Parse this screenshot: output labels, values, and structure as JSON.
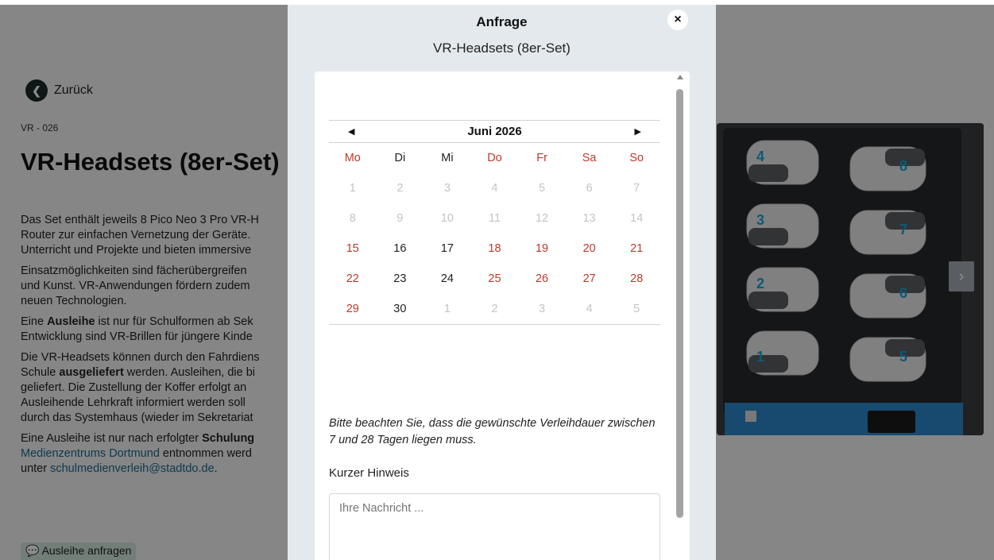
{
  "page": {
    "back_label": "Zurück",
    "breadcrumb": "VR - 026",
    "title": "VR-Headsets (8er-Set)",
    "desc": [
      "Das Set enthält jeweils 8 Pico Neo 3 Pro VR-H",
      "Router zur einfachen Vernetzung der Geräte.",
      "Unterricht und Projekte und bieten immersive"
    ],
    "desc2": [
      "Einsatzmöglichkeiten sind fächerübergreifen",
      "und Kunst. VR-Anwendungen fördern zudem",
      "neuen Technologien."
    ],
    "desc3_pre": "Eine ",
    "desc3_bold": "Ausleihe",
    "desc3_post": " ist nur für Schulformen ab Sek",
    "desc3_line2": "Entwicklung sind VR-Brillen für jüngere Kinde",
    "desc4_line1": "Die VR-Headsets können durch den Fahrdiens",
    "desc4_pre": "Schule ",
    "desc4_bold": "ausgeliefert",
    "desc4_post": " werden. Ausleihen, die bi",
    "desc4_line3": "geliefert. Die Zustellung der Koffer erfolgt an",
    "desc4_line4": "Ausleihende Lehrkraft informiert werden soll",
    "desc4_line5": "durch das Systemhaus (wieder im Sekretariat",
    "desc5_pre": "Eine Ausleihe ist nur nach erfolgter ",
    "desc5_bold": "Schulung",
    "desc5_link1": "Medienzentrums Dortmund",
    "desc5_post1": " entnommen werd",
    "desc5_pre2": "unter ",
    "desc5_link2": "schulmedienverleih@stadtdo.de",
    "desc5_post2": ".",
    "request_button": "Ausleihe anfragen",
    "request_icon": "speech-bubble-icon",
    "next_icon": "chevron-right-icon"
  },
  "modal": {
    "title": "Anfrage",
    "subtitle": "VR-Headsets (8er-Set)",
    "close_icon": "close-icon",
    "calendar": {
      "month": "Juni 2026",
      "prev_icon": "triangle-left-icon",
      "next_icon": "triangle-right-icon",
      "weekdays": [
        "Mo",
        "Di",
        "Mi",
        "Do",
        "Fr",
        "Sa",
        "So"
      ],
      "weeks": [
        [
          {
            "d": "1",
            "s": "muted"
          },
          {
            "d": "2",
            "s": "muted"
          },
          {
            "d": "3",
            "s": "muted"
          },
          {
            "d": "4",
            "s": "muted"
          },
          {
            "d": "5",
            "s": "muted"
          },
          {
            "d": "6",
            "s": "muted"
          },
          {
            "d": "7",
            "s": "muted"
          }
        ],
        [
          {
            "d": "8",
            "s": "muted"
          },
          {
            "d": "9",
            "s": "muted"
          },
          {
            "d": "10",
            "s": "muted"
          },
          {
            "d": "11",
            "s": "muted"
          },
          {
            "d": "12",
            "s": "muted"
          },
          {
            "d": "13",
            "s": "muted"
          },
          {
            "d": "14",
            "s": "muted"
          }
        ],
        [
          {
            "d": "15",
            "s": "red"
          },
          {
            "d": "16",
            "s": "blk"
          },
          {
            "d": "17",
            "s": "blk"
          },
          {
            "d": "18",
            "s": "red"
          },
          {
            "d": "19",
            "s": "red"
          },
          {
            "d": "20",
            "s": "red"
          },
          {
            "d": "21",
            "s": "red"
          }
        ],
        [
          {
            "d": "22",
            "s": "red"
          },
          {
            "d": "23",
            "s": "blk"
          },
          {
            "d": "24",
            "s": "blk"
          },
          {
            "d": "25",
            "s": "red"
          },
          {
            "d": "26",
            "s": "red"
          },
          {
            "d": "27",
            "s": "red"
          },
          {
            "d": "28",
            "s": "red"
          }
        ],
        [
          {
            "d": "29",
            "s": "red"
          },
          {
            "d": "30",
            "s": "blk"
          },
          {
            "d": "1",
            "s": "muted"
          },
          {
            "d": "2",
            "s": "muted"
          },
          {
            "d": "3",
            "s": "muted"
          },
          {
            "d": "4",
            "s": "muted"
          },
          {
            "d": "5",
            "s": "muted"
          }
        ]
      ]
    },
    "notice": "Bitte beachten Sie, dass die gewünschte Verleihdauer zwischen 7 und 28 Tagen liegen muss.",
    "hint_label": "Kurzer Hinweis",
    "message_placeholder": "Ihre Nachricht ..."
  }
}
